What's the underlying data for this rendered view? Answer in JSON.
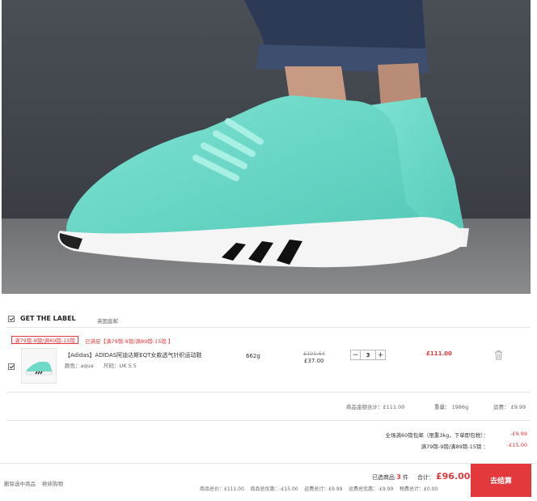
{
  "store": {
    "name": "GET THE LABEL",
    "origin": "英国直邮"
  },
  "promo": {
    "tag": "满79镑-9镑/满89镑-15镑",
    "applied_prefix": "已满足",
    "applied_detail": "【满79镑-9镑/满89镑-15镑 】"
  },
  "item": {
    "title": "【Adidas】ADIDAS阿迪达斯EQT女款透气针织运动鞋",
    "color_label": "颜色：aqua",
    "size_label": "尺码：UK 5.5",
    "weight": "662g",
    "original_price": "£101.64",
    "price": "£37.00",
    "quantity": "3",
    "subtotal": "£111.00",
    "minus": "−",
    "plus": "+"
  },
  "store_summary": {
    "goods_total": "商品金额合计：£111.00",
    "weight": "重量：  1986g",
    "shipping": "运费：  £9.99"
  },
  "discounts": [
    {
      "label": "全场满60镑包邮（限重3kg，下单即包税）：",
      "value": "-£9.99"
    },
    {
      "label": "满79镑-9镑/满89镑-15镑 ：",
      "value": "-£15.00"
    }
  ],
  "footer": {
    "delete_selected": "删除选中商品",
    "continue_shopping": "继续购物",
    "selected_prefix": "已选商品",
    "selected_count": "3",
    "selected_suffix": "件",
    "total_label": "合计：",
    "total_value": "£96.00",
    "breakdown": "商品总价：£111.00    商品总优惠：-£15.00    运费总计：£9.99    运费总优惠：-£9.99    税费总计：£0.00",
    "checkout": "去结算"
  }
}
